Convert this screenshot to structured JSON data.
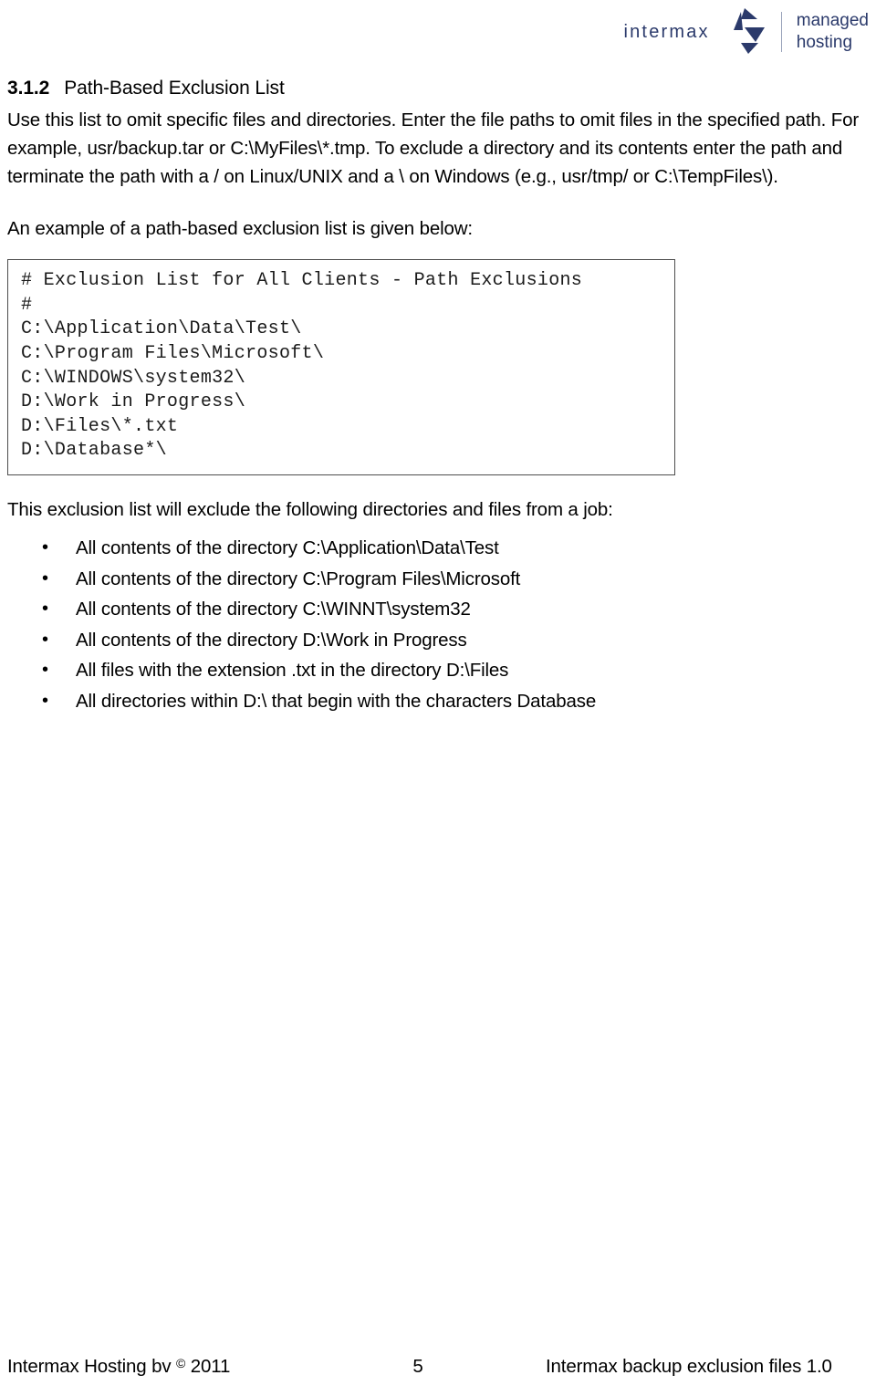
{
  "header": {
    "brand_name": "intermax",
    "tagline_line1": "managed",
    "tagline_line2": "hosting",
    "brand_color": "#2b3a6b",
    "logo_icon": "intermax-arrows-logo"
  },
  "section": {
    "number": "3.1.2",
    "title": "Path-Based Exclusion List",
    "intro": "Use this list to omit specific files and directories. Enter the file paths to omit files in the specified path. For example, usr/backup.tar or C:\\MyFiles\\*.tmp. To exclude a directory and its contents enter the path and terminate the path with a / on Linux/UNIX and a \\ on Windows (e.g., usr/tmp/ or C:\\TempFiles\\).",
    "example_lead": "An example of a path-based exclusion list is given below:",
    "result_lead": "This exclusion list will exclude the following directories and files from a job:"
  },
  "code_block": {
    "lines": [
      "# Exclusion List for All Clients - Path Exclusions",
      "#",
      "C:\\Application\\Data\\Test\\",
      "C:\\Program Files\\Microsoft\\",
      "C:\\WINDOWS\\system32\\",
      "D:\\Work in Progress\\",
      "D:\\Files\\*.txt",
      "D:\\Database*\\"
    ],
    "text": "# Exclusion List for All Clients - Path Exclusions\n#\nC:\\Application\\Data\\Test\\\nC:\\Program Files\\Microsoft\\\nC:\\WINDOWS\\system32\\\nD:\\Work in Progress\\\nD:\\Files\\*.txt\nD:\\Database*\\"
  },
  "excluded_items": [
    "All contents of the directory C:\\Application\\Data\\Test",
    "All contents of the directory C:\\Program Files\\Microsoft",
    "All contents of the directory C:\\WINNT\\system32",
    "All contents of the directory D:\\Work in Progress",
    "All files with the extension .txt in the directory D:\\Files",
    "All directories within D:\\ that begin with the characters Database"
  ],
  "footer": {
    "left_prefix": "Intermax Hosting bv ",
    "copyright_symbol": "©",
    "left_suffix": " 2011",
    "page_number": "5",
    "right": "Intermax backup exclusion files 1.0"
  }
}
